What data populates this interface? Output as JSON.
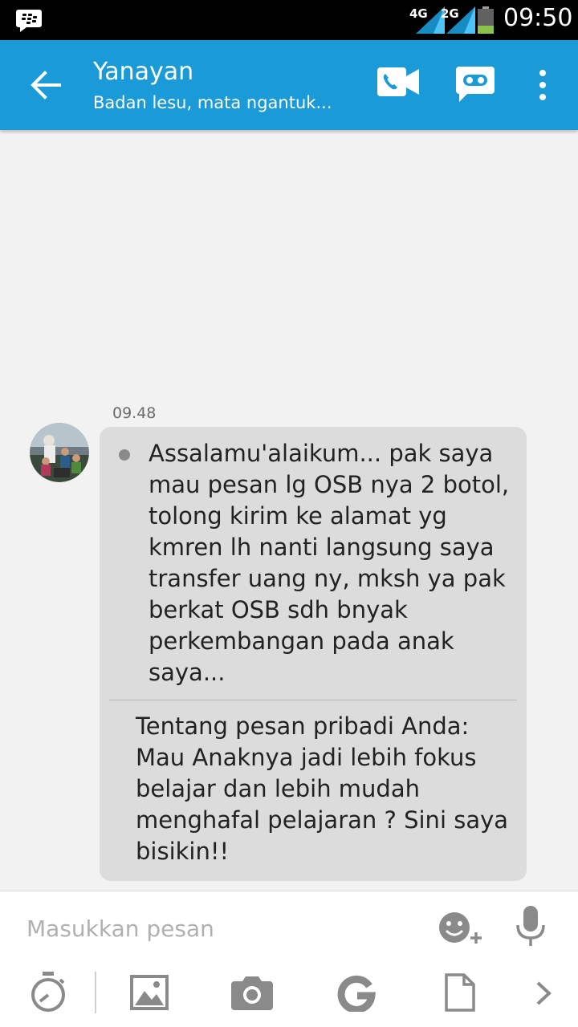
{
  "status_bar": {
    "network_1": "4G",
    "network_2": "2G",
    "time": "09:50"
  },
  "header": {
    "contact_name": "Yanayan",
    "contact_status": "Badan lesu, mata ngantuk..."
  },
  "conversation": {
    "timestamp": "09.48",
    "message": "Assalamu'alaikum...  pak saya mau pesan lg OSB nya 2 botol, tolong kirim ke alamat yg kmren lh nanti langsung saya transfer uang ny, mksh ya pak berkat OSB sdh bnyak perkembangan pada anak saya...",
    "personal_message": "Tentang pesan pribadi Anda: Mau Anaknya jadi lebih fokus belajar dan lebih mudah menghafal pelajaran ? Sini saya bisikin!!"
  },
  "composer": {
    "placeholder": "Masukkan pesan",
    "value": ""
  },
  "icons": {
    "status_bar": [
      "bbm-icon",
      "signal-icon",
      "battery-icon"
    ],
    "header": [
      "back-arrow-icon",
      "video-call-icon",
      "voice-chat-icon",
      "more-vert-icon"
    ],
    "composer": [
      "emoji-icon",
      "microphone-icon",
      "timer-icon",
      "picture-icon",
      "camera-icon",
      "google-icon",
      "file-icon",
      "chevron-right-icon"
    ]
  },
  "colors": {
    "app_bar": "#1a9bd7",
    "bubble": "#dcdcdc",
    "background": "#f2f2f2",
    "battery_fill": "#8bc34a"
  }
}
